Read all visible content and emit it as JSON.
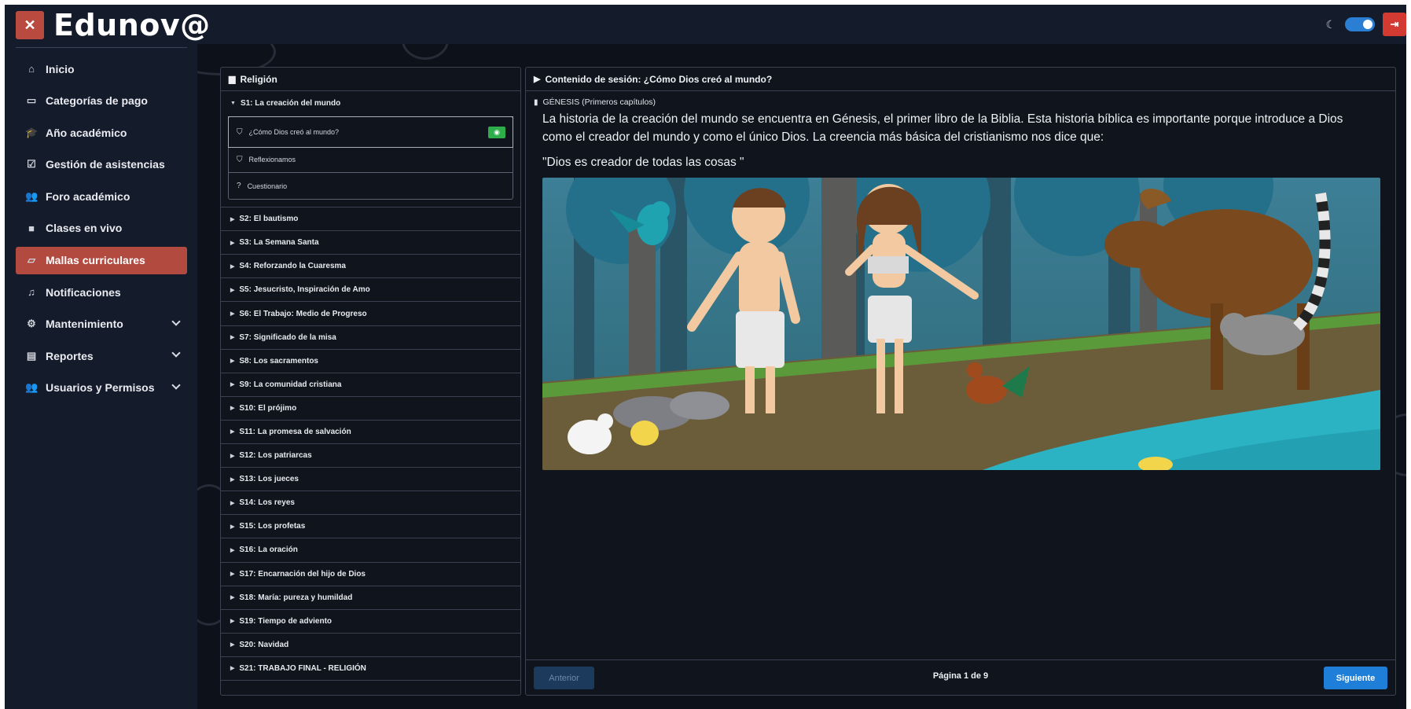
{
  "app": {
    "brand": "Edunov@",
    "close_glyph": "✕",
    "logout_glyph": "⇥"
  },
  "sidebar": {
    "items": [
      {
        "label": "Inicio",
        "icon": "home-icon",
        "glyph": "⌂"
      },
      {
        "label": "Categorías de pago",
        "icon": "money-icon",
        "glyph": "▭"
      },
      {
        "label": "Año académico",
        "icon": "graduation-cap-icon",
        "glyph": "🎓"
      },
      {
        "label": "Gestión de asistencias",
        "icon": "calendar-check-icon",
        "glyph": "☑"
      },
      {
        "label": "Foro académico",
        "icon": "users-icon",
        "glyph": "👥"
      },
      {
        "label": "Clases en vivo",
        "icon": "video-icon",
        "glyph": "■"
      },
      {
        "label": "Mallas curriculares",
        "icon": "folder-open-icon",
        "glyph": "▱",
        "active": true
      },
      {
        "label": "Notificaciones",
        "icon": "bell-icon",
        "glyph": "♫"
      },
      {
        "label": "Mantenimiento",
        "icon": "cogs-icon",
        "glyph": "⚙",
        "expandable": true
      },
      {
        "label": "Reportes",
        "icon": "file-icon",
        "glyph": "▤",
        "expandable": true
      },
      {
        "label": "Usuarios y Permisos",
        "icon": "users-cog-icon",
        "glyph": "👥",
        "expandable": true
      }
    ]
  },
  "topbar": {
    "theme_toggle_on": true,
    "moon_glyph": "☾"
  },
  "course": {
    "title": "Religión",
    "open_session": {
      "label": "S1: La creación del mundo",
      "lessons": [
        {
          "label": "¿Cómo Dios creó al mundo?",
          "icon": "bookmark-icon",
          "glyph": "⛉",
          "current": true,
          "eye_glyph": "◉"
        },
        {
          "label": "Reflexionamos",
          "icon": "bookmark-icon",
          "glyph": "⛉"
        },
        {
          "label": "Cuestionario",
          "icon": "question-circle-icon",
          "glyph": "?"
        }
      ]
    },
    "sessions": [
      "S2: El bautismo",
      "S3: La Semana Santa",
      "S4: Reforzando la Cuaresma",
      "S5: Jesucristo, Inspiración de Amo",
      "S6: El Trabajo: Medio de Progreso",
      "S7: Significado de la misa",
      "S8: Los sacramentos",
      "S9: La comunidad cristiana",
      "S10: El prójimo",
      "S11: La promesa de salvación",
      "S12: Los patriarcas",
      "S13: Los jueces",
      "S14: Los reyes",
      "S15: Los profetas",
      "S16: La oración",
      "S17: Encarnación del hijo de Dios",
      "S18: María: pureza y humildad",
      "S19: Tiempo de adviento",
      "S20: Navidad",
      "S21: TRABAJO FINAL - RELIGIÓN"
    ]
  },
  "content": {
    "header": "Contenido de sesión: ¿Cómo Dios creó al mundo?",
    "chapter": "GÉNESIS (Primeros capítulos)",
    "paragraph": "La historia de la creación del mundo se encuentra en Génesis, el primer libro de la Biblia. Esta historia bíblica es importante porque introduce a Dios como el creador del mundo y como el único Dios. La creencia más básica del cristianismo nos dice que:",
    "quote": "\"Dios es creador de todas las cosas \"",
    "image_alt": "illustration-adam-eve-animals",
    "prev_label": "Anterior",
    "page_indicator": "Página 1 de 9",
    "next_label": "Siguiente"
  }
}
